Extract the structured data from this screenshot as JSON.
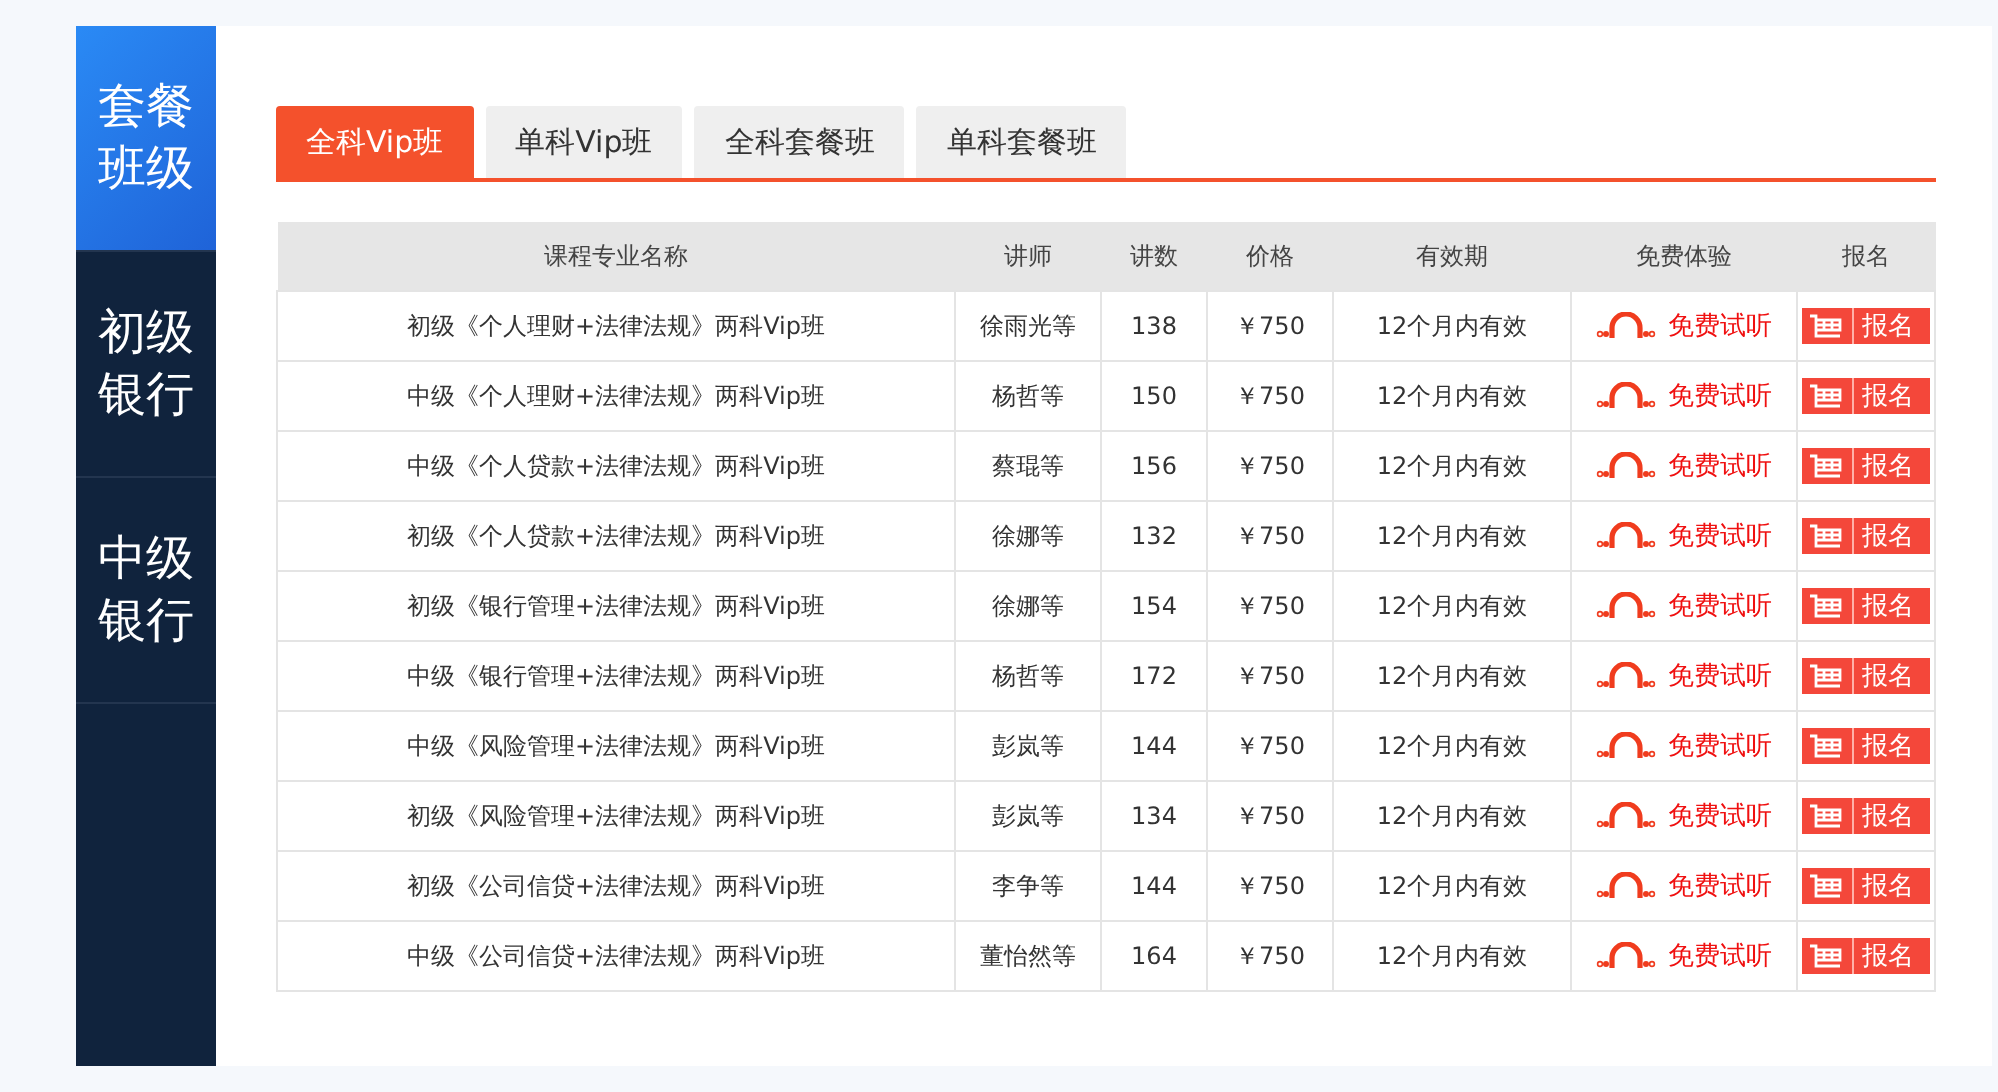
{
  "sidebar": {
    "items": [
      {
        "label": "套餐班级",
        "selected": true
      },
      {
        "label": "初级银行",
        "selected": false
      },
      {
        "label": "中级银行",
        "selected": false
      }
    ]
  },
  "tabs": [
    {
      "label": "全科Vip班",
      "selected": true
    },
    {
      "label": "单科Vip班",
      "selected": false
    },
    {
      "label": "全科套餐班",
      "selected": false
    },
    {
      "label": "单科套餐班",
      "selected": false
    }
  ],
  "table": {
    "columns": [
      "课程专业名称",
      "讲师",
      "讲数",
      "价格",
      "有效期",
      "免费体验",
      "报名"
    ],
    "rows": [
      {
        "name": "初级《个人理财+法律法规》两科Vip班",
        "teacher": "徐雨光等",
        "lectures": "138",
        "price": "￥750",
        "validity": "12个月内有效",
        "trial": "免费试听",
        "signup": "报名"
      },
      {
        "name": "中级《个人理财+法律法规》两科Vip班",
        "teacher": "杨哲等",
        "lectures": "150",
        "price": "￥750",
        "validity": "12个月内有效",
        "trial": "免费试听",
        "signup": "报名"
      },
      {
        "name": "中级《个人贷款+法律法规》两科Vip班",
        "teacher": "蔡琨等",
        "lectures": "156",
        "price": "￥750",
        "validity": "12个月内有效",
        "trial": "免费试听",
        "signup": "报名"
      },
      {
        "name": "初级《个人贷款+法律法规》两科Vip班",
        "teacher": "徐娜等",
        "lectures": "132",
        "price": "￥750",
        "validity": "12个月内有效",
        "trial": "免费试听",
        "signup": "报名"
      },
      {
        "name": "初级《银行管理+法律法规》两科Vip班",
        "teacher": "徐娜等",
        "lectures": "154",
        "price": "￥750",
        "validity": "12个月内有效",
        "trial": "免费试听",
        "signup": "报名"
      },
      {
        "name": "中级《银行管理+法律法规》两科Vip班",
        "teacher": "杨哲等",
        "lectures": "172",
        "price": "￥750",
        "validity": "12个月内有效",
        "trial": "免费试听",
        "signup": "报名"
      },
      {
        "name": "中级《风险管理+法律法规》两科Vip班",
        "teacher": "彭岚等",
        "lectures": "144",
        "price": "￥750",
        "validity": "12个月内有效",
        "trial": "免费试听",
        "signup": "报名"
      },
      {
        "name": "初级《风险管理+法律法规》两科Vip班",
        "teacher": "彭岚等",
        "lectures": "134",
        "price": "￥750",
        "validity": "12个月内有效",
        "trial": "免费试听",
        "signup": "报名"
      },
      {
        "name": "初级《公司信贷+法律法规》两科Vip班",
        "teacher": "李争等",
        "lectures": "144",
        "price": "￥750",
        "validity": "12个月内有效",
        "trial": "免费试听",
        "signup": "报名"
      },
      {
        "name": "中级《公司信贷+法律法规》两科Vip班",
        "teacher": "董怡然等",
        "lectures": "164",
        "price": "￥750",
        "validity": "12个月内有效",
        "trial": "免费试听",
        "signup": "报名"
      }
    ]
  }
}
